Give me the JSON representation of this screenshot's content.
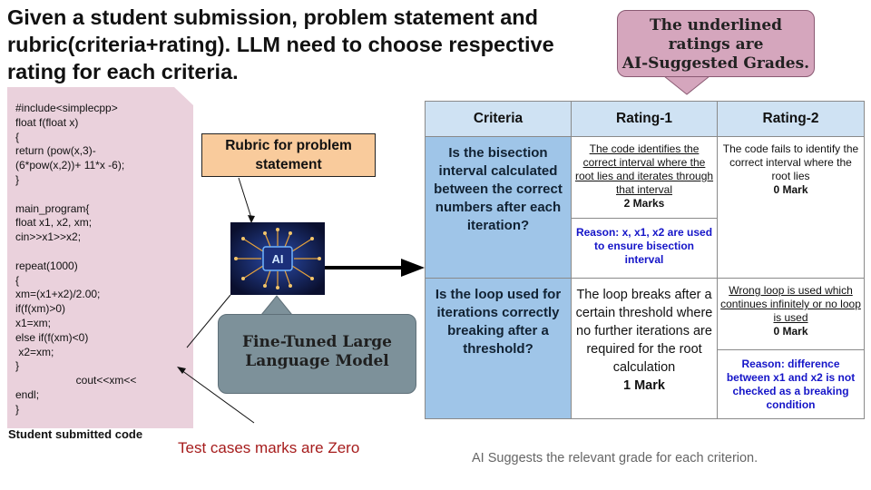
{
  "title": "Given a student submission, problem statement and rubric(criteria+rating). LLM need to choose respective rating for each criteria.",
  "callout": {
    "line1": "The underlined",
    "line2": "ratings are",
    "line3": "AI-Suggested Grades."
  },
  "code": {
    "text": "#include<simplecpp>\nfloat f(float x)\n{\nreturn (pow(x,3)-\n(6*pow(x,2))+ 11*x -6);\n}\n\nmain_program{\nfloat x1, x2, xm;\ncin>>x1>>x2;\n\nrepeat(1000)\n{\nxm=(x1+x2)/2.00;\nif(f(xm)>0)\nx1=xm;\nelse if(f(xm)<0)\n x2=xm;\n}\n                    cout<<xm<<\nendl;\n}",
    "caption": "Student submitted code"
  },
  "test_cases_note": "Test cases marks are  Zero",
  "rubric_label": "Rubric for problem statement",
  "ai_chip_label": "AI",
  "model_label": "Fine-Tuned Large Language Model",
  "footer_note": "AI Suggests the relevant grade for each criterion.",
  "table": {
    "headers": [
      "Criteria",
      "Rating-1",
      "Rating-2"
    ],
    "rows": [
      {
        "criterion": "Is the bisection interval calculated between the correct numbers after each iteration?",
        "rating1": {
          "text": "The code identifies the correct interval where the root lies and iterates through that interval",
          "marks": "2 Marks",
          "reason": "Reason: x, x1, x2 are used to ensure bisection interval"
        },
        "rating2": {
          "text": "The code fails to identify the correct interval where the root lies",
          "marks": "0 Mark"
        }
      },
      {
        "criterion": "Is the loop used for iterations correctly breaking after a threshold?",
        "rating1": {
          "text": "The loop breaks after a certain threshold where no further iterations are required for the root calculation",
          "marks": "1  Mark"
        },
        "rating2": {
          "text": "Wrong loop is used which continues infinitely or no loop is used",
          "marks": "0 Mark",
          "reason": "Reason: difference between x1 and x2 is not checked as a breaking condition"
        }
      }
    ]
  },
  "colors": {
    "callout": "#d5a6bd",
    "code_box": "#ead1dc",
    "rubric_box": "#f9cb9c",
    "model_box": "#7d919a",
    "header": "#cfe2f3",
    "criteria": "#9fc5e8",
    "reason_text": "#1515c8",
    "test_cases_text": "#a61c1c"
  }
}
